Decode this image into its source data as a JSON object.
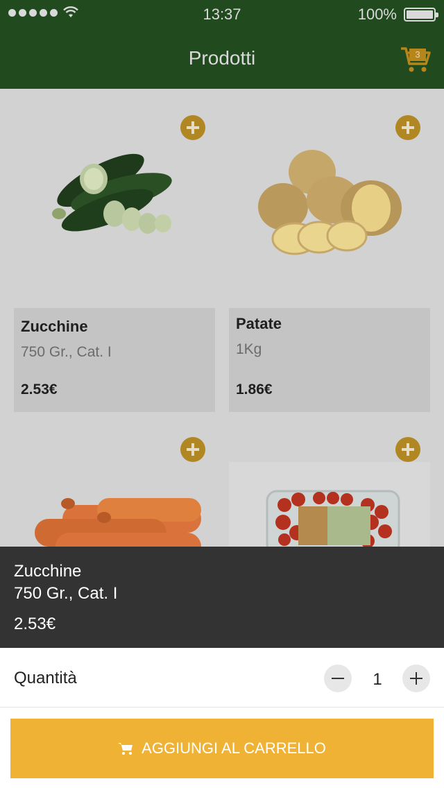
{
  "status_bar": {
    "time": "13:37",
    "battery": "100%"
  },
  "header": {
    "title": "Prodotti",
    "cart_count": "3"
  },
  "products": [
    {
      "name": "Zucchine",
      "desc": "750 Gr., Cat. I",
      "price": "2.53€"
    },
    {
      "name": "Patate",
      "desc": "1Kg",
      "price": "1.86€"
    },
    {
      "name": "",
      "desc": "",
      "price": ""
    },
    {
      "name": "",
      "desc": "",
      "price": ""
    }
  ],
  "product_images": [
    "zucchini-image",
    "potatoes-image",
    "carrots-image",
    "cherry-tomatoes-image"
  ],
  "detail": {
    "name": "Zucchine",
    "desc": "750 Gr., Cat. I",
    "price": "2.53€"
  },
  "quantity": {
    "label": "Quantità",
    "value": "1"
  },
  "add_to_cart": {
    "label": "AGGIUNGI AL CARRELLO"
  },
  "colors": {
    "header": "#214b1e",
    "accent": "#f0b234",
    "panel": "#333333",
    "plus_icon": "#b08722"
  }
}
